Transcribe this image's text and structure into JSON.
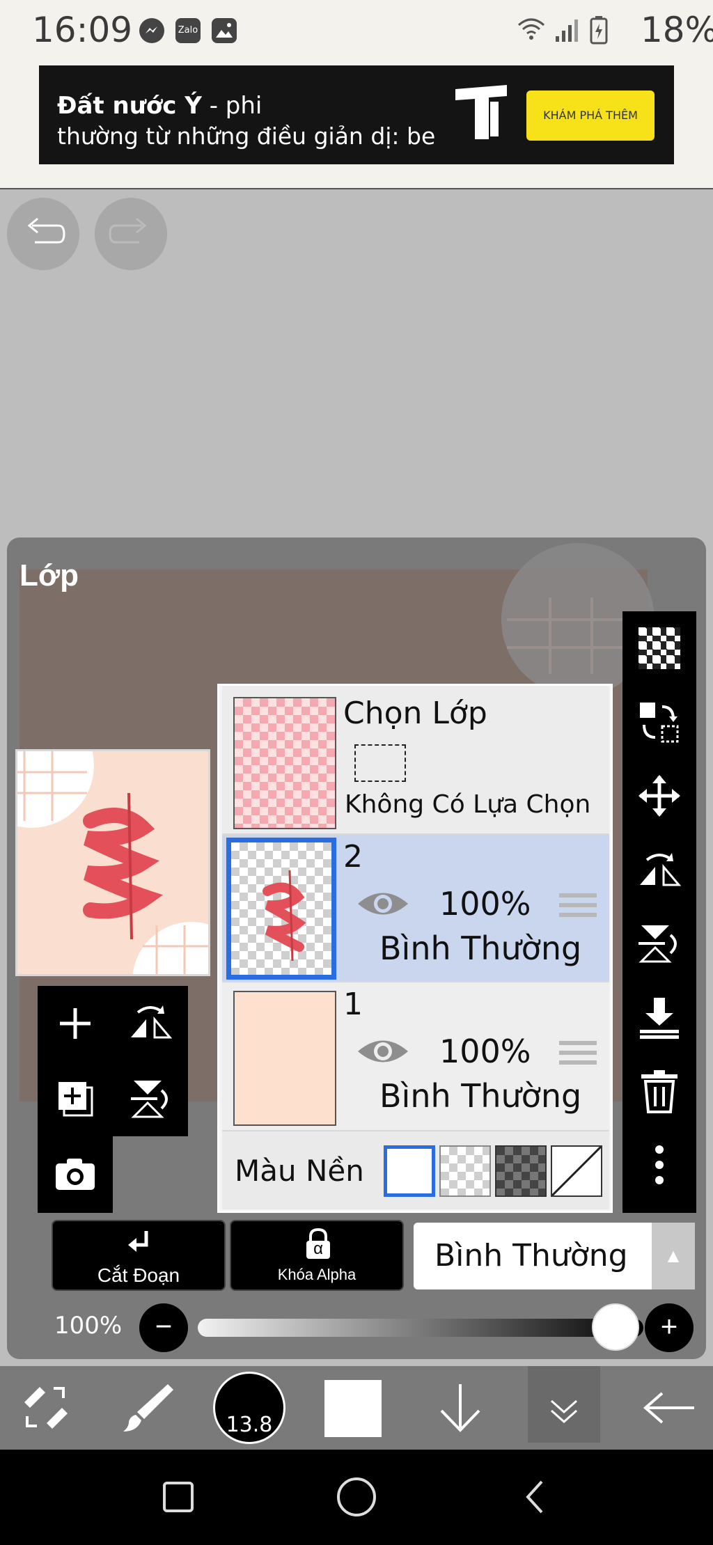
{
  "status_bar": {
    "time": "16:09",
    "notification_icons": [
      "messenger-icon",
      "zalo-icon",
      "gallery-icon"
    ],
    "zalo_label": "Zalo",
    "system_icons": [
      "wifi-icon",
      "signal-icon",
      "battery-icon"
    ],
    "battery_percent": "18%"
  },
  "ad": {
    "headline_bold": "Đất nước Ý",
    "headline_light": " - phi",
    "line2": "thường từ những điều giản dị: be",
    "cta": "KHÁM PHÁ THÊM",
    "cta_color": "#f7e21a"
  },
  "history": {
    "undo_icon": "undo-icon",
    "redo_icon": "redo-icon"
  },
  "panel": {
    "title": "Lớp"
  },
  "selection_row": {
    "title": "Chọn Lớp",
    "status": "Không Có Lựa Chọn"
  },
  "layers": [
    {
      "name": "2",
      "opacity": "100%",
      "blend": "Bình Thường",
      "selected": true,
      "visible": true
    },
    {
      "name": "1",
      "opacity": "100%",
      "blend": "Bình Thường",
      "selected": false,
      "visible": true
    }
  ],
  "background_row": {
    "label": "Màu Nền",
    "options": [
      "white",
      "light-checker",
      "dark-checker",
      "none"
    ],
    "selected": "white"
  },
  "left_tools": [
    "add-layer-icon",
    "flip-horizontal-icon",
    "add-copy-layer-icon",
    "flip-vertical-icon",
    "camera-icon"
  ],
  "right_tools": [
    "checker-icon",
    "transform-select-icon",
    "move-icon",
    "flip-horizontal-icon",
    "flip-vertical-icon",
    "merge-down-icon",
    "trash-icon",
    "more-icon"
  ],
  "controls": {
    "clip_label": "Cắt Đoạn",
    "alpha_lock_label": "Khóa Alpha",
    "alpha_symbol": "α",
    "blend_mode": "Bình Thường",
    "blend_arrow": "▲",
    "opacity_label": "100%",
    "opacity_value": 1.0,
    "minus": "−",
    "plus": "+"
  },
  "bottom_toolbar": {
    "brush_size": "13.8",
    "items": [
      "transform-icon",
      "brush-icon",
      "brush-size-indicator",
      "color-swatch",
      "arrow-down-icon",
      "collapse-icon",
      "back-arrow-icon"
    ],
    "color": "#ffffff"
  },
  "accent_color": "#2a6de0",
  "selected_row_color": "#c9d6ee"
}
